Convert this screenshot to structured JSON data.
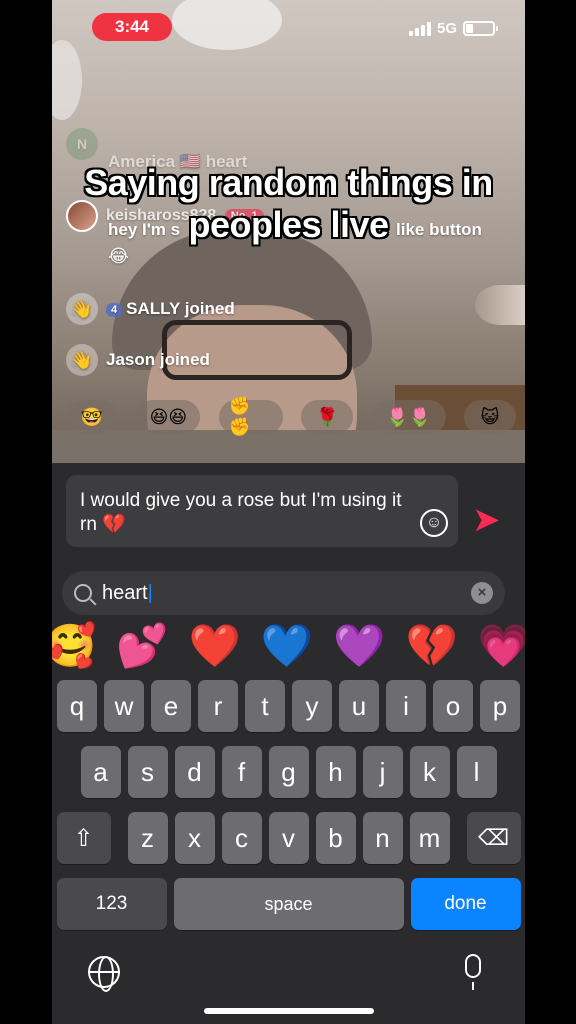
{
  "status_bar": {
    "time": "3:44",
    "network": "5G"
  },
  "caption": {
    "line1": "Saying random things in",
    "line2": "peoples live"
  },
  "comments": [
    {
      "avatar_letter": "N",
      "user": "",
      "text": "America 🇺🇸 heart"
    },
    {
      "user": "keishaross828",
      "badge": "No. 1",
      "text_start": "hey I'm s",
      "text_end": "like button",
      "emoji": "😂"
    }
  ],
  "joins": [
    {
      "level": "4",
      "text": "SALLY joined"
    },
    {
      "text": "Jason joined"
    }
  ],
  "gifts": [
    "🤓",
    "😆😆",
    "✊✊",
    "🌹",
    "🌷🌷",
    "😺"
  ],
  "message_input": {
    "value": "I would give you a rose but I'm using it rn 💔"
  },
  "emoji_search": {
    "value": "heart"
  },
  "emoji_results": [
    "🥰",
    "💕",
    "❤️",
    "💙",
    "💜",
    "💔",
    "💗",
    "🖤"
  ],
  "keyboard": {
    "row1": [
      "q",
      "w",
      "e",
      "r",
      "t",
      "y",
      "u",
      "i",
      "o",
      "p"
    ],
    "row2": [
      "a",
      "s",
      "d",
      "f",
      "g",
      "h",
      "j",
      "k",
      "l"
    ],
    "row3": [
      "z",
      "x",
      "c",
      "v",
      "b",
      "n",
      "m"
    ],
    "numbers_label": "123",
    "space_label": "space",
    "done_label": "done",
    "shift_icon": "⇧",
    "backspace_icon": "⌫"
  },
  "colors": {
    "accent_send": "#fe2c55",
    "done_blue": "#0a84ff",
    "time_pill": "#ef3340"
  }
}
